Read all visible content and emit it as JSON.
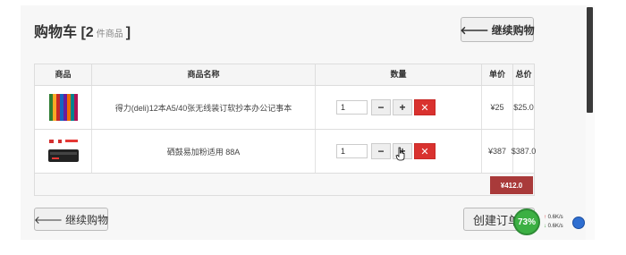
{
  "cart": {
    "title_main": "购物车",
    "title_open": "[2",
    "title_count_label": "件商品",
    "title_close": "]",
    "continue_top_label": "继续购物",
    "continue_bottom_label": "继续购物",
    "create_order_label": "创建订单"
  },
  "table": {
    "headers": [
      "商品",
      "商品名称",
      "数量",
      "单价",
      "总价"
    ],
    "rows": [
      {
        "name": "得力(deli)12本A5/40张无线装订软抄本办公记事本",
        "qty": "1",
        "price": "¥25",
        "total": "$25.0",
        "thumb_icon": "notebook-colorful-image"
      },
      {
        "name": "硒鼓易加粉适用 88A",
        "qty": "1",
        "price": "¥387",
        "total": "$387.0",
        "thumb_icon": "toner-cartridge-image"
      }
    ],
    "grand_total": "¥412.0"
  },
  "controls": {
    "minus": "−",
    "plus": "+",
    "remove": "✕"
  },
  "net_widget": {
    "percent": "73%",
    "up_speed": "0.6K/s",
    "down_speed": "0.6K/s"
  }
}
